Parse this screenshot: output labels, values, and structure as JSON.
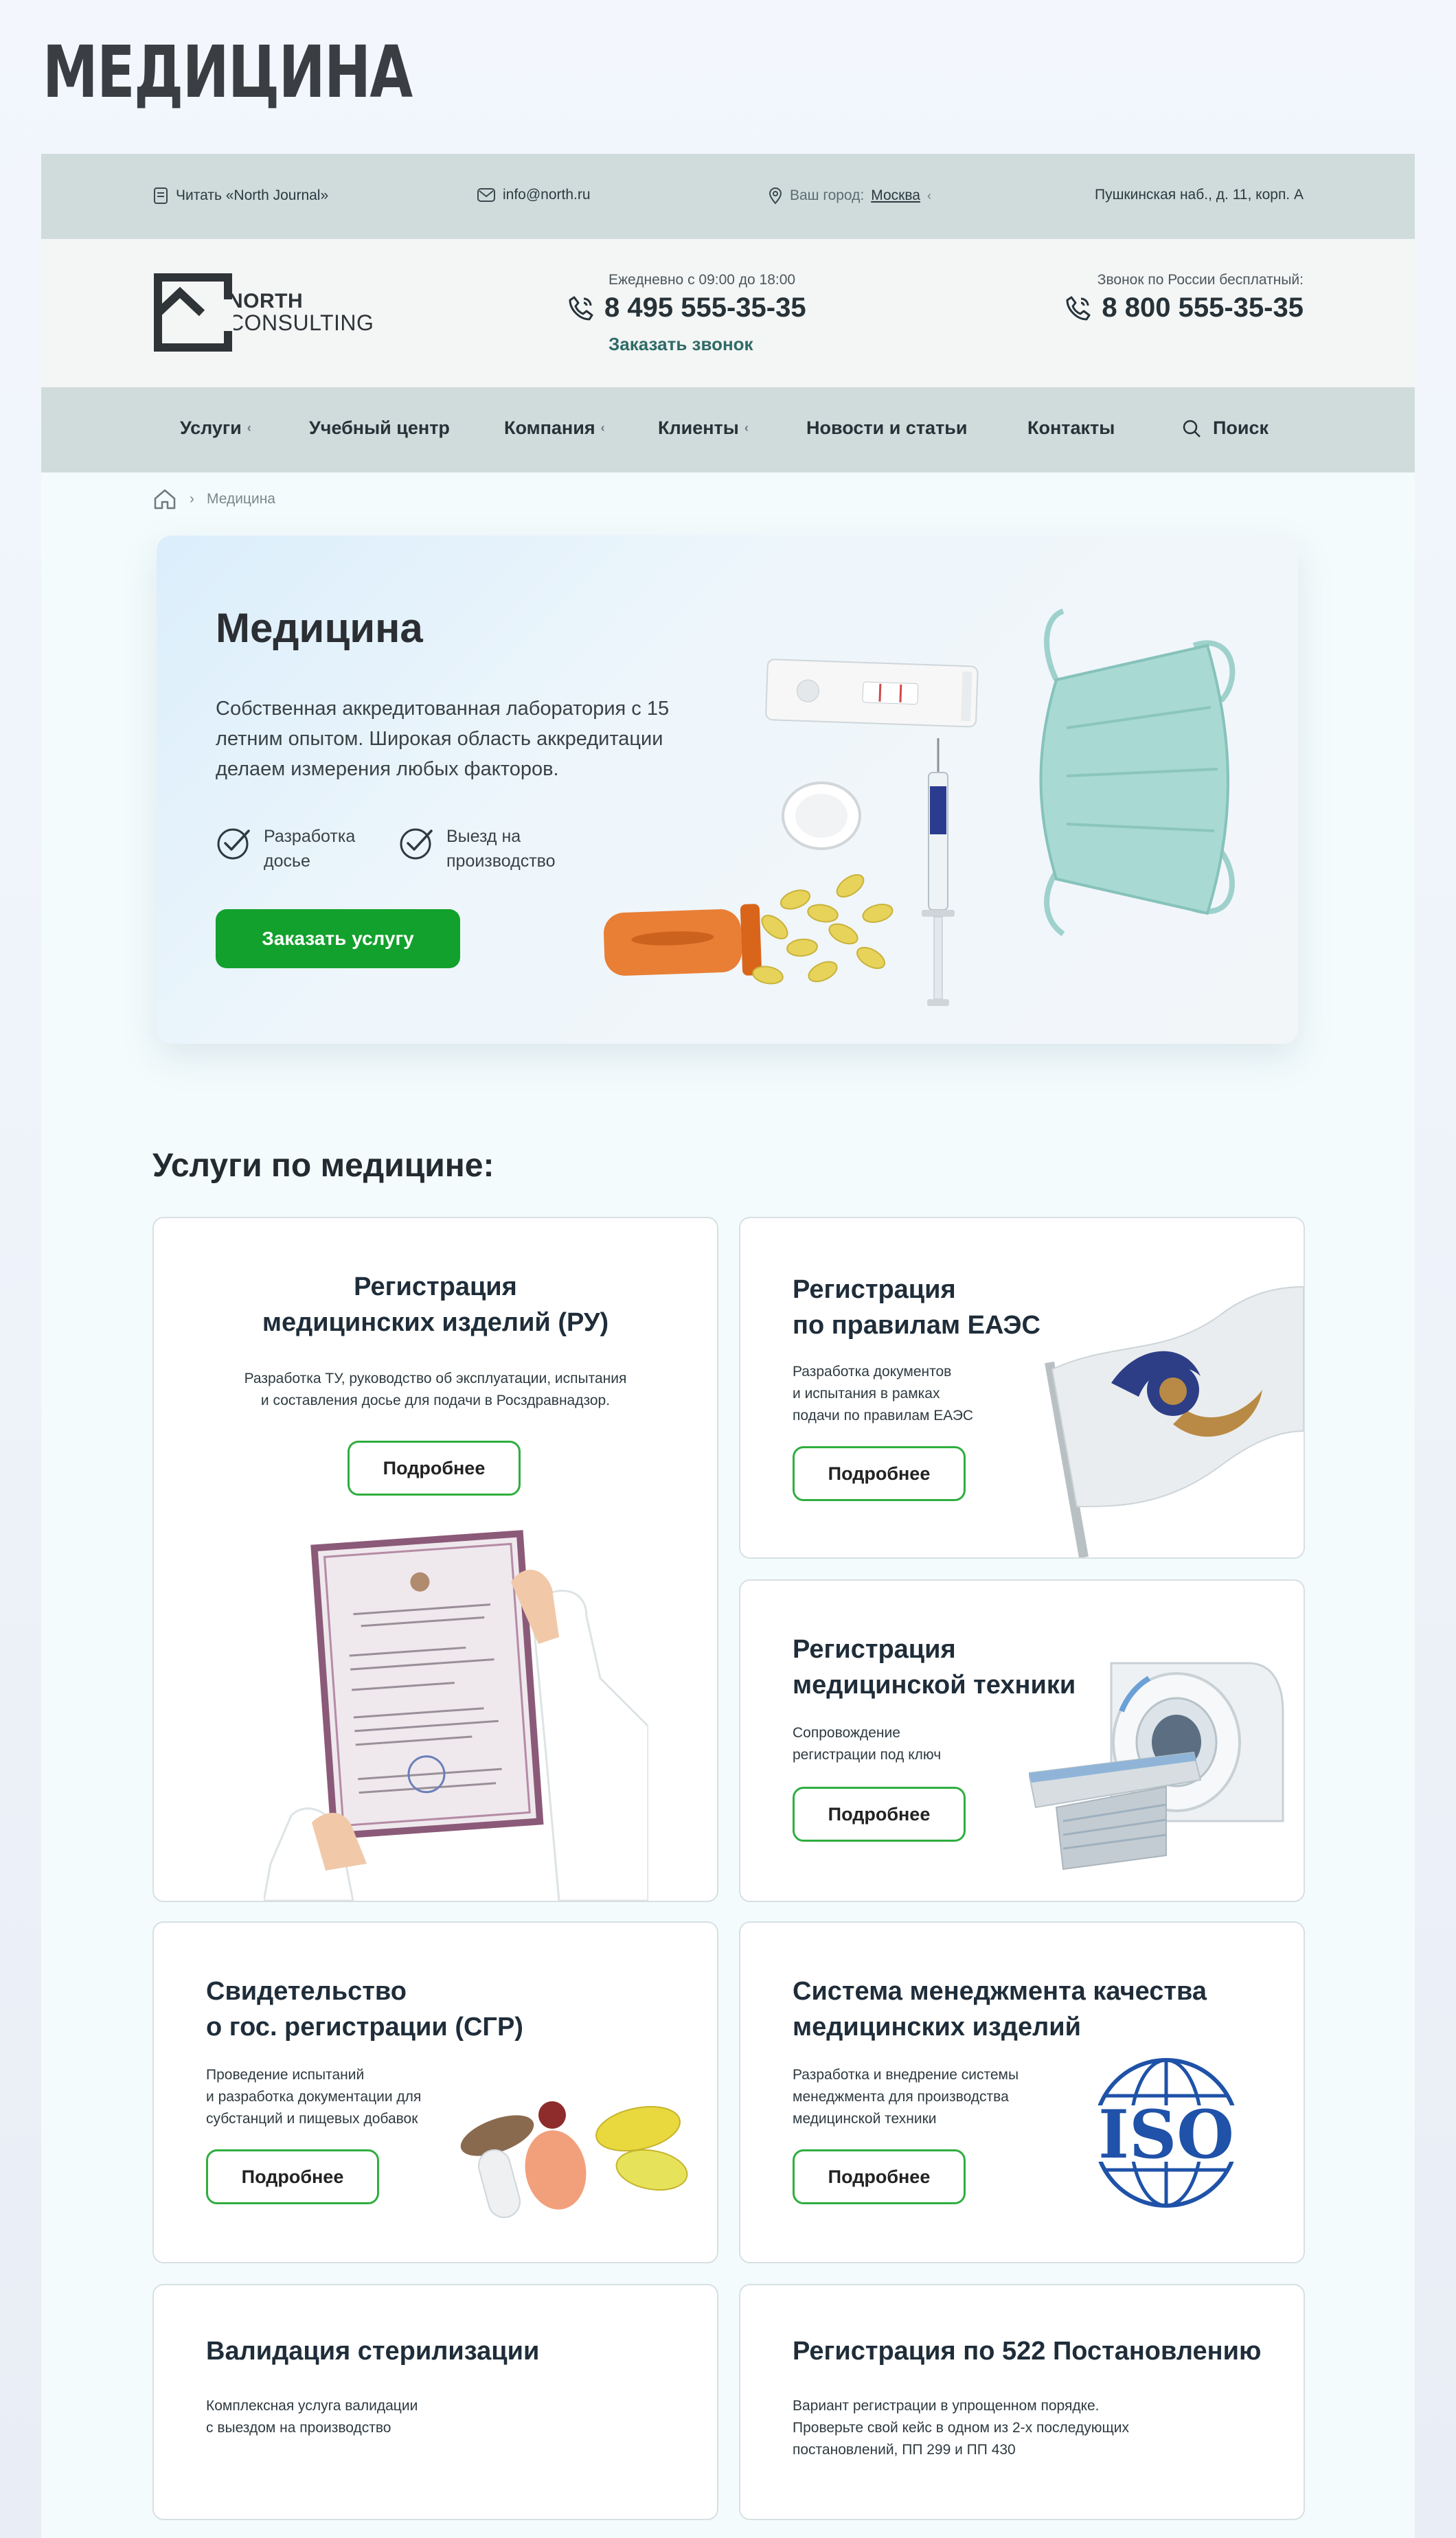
{
  "presentation_title": "МЕДИЦИНА",
  "topbar": {
    "journal": "Читать «North Journal»",
    "email": "info@north.ru",
    "city_label": "Ваш город:",
    "city": "Москва",
    "address": "Пушкинская наб., д. 11, корп. А"
  },
  "header": {
    "logo_line1": "NORTH",
    "logo_line2": "CONSULTING",
    "hours": "Ежедневно с 09:00 до 18:00",
    "phone_main": "8 495 555-35-35",
    "callback": "Заказать звонок",
    "free_label": "Звонок по России бесплатный:",
    "phone_free": "8 800 555-35-35"
  },
  "nav": {
    "items": [
      "Услуги",
      "Учебный центр",
      "Компания",
      "Клиенты",
      "Новости и статьи",
      "Контакты"
    ],
    "search": "Поиск"
  },
  "breadcrumb": {
    "current": "Медицина"
  },
  "hero": {
    "title": "Медицина",
    "text": "Собственная аккредитованная лаборатория с 15 летним опытом. Широкая область аккредитации делаем измерения любых факторов.",
    "feature1_l1": "Разработка",
    "feature1_l2": "досье",
    "feature2_l1": "Выезд на",
    "feature2_l2": "производство",
    "button": "Заказать услугу"
  },
  "services": {
    "title": "Услуги по медицине:",
    "more": "Подробнее",
    "cards": [
      {
        "t1": "Регистрация",
        "t2": "медицинских изделий (РУ)",
        "d1": "Разработка ТУ, руководство об эксплуатации, испытания",
        "d2": "и составления досье для подачи в Росздравнадзор."
      },
      {
        "t1": "Регистрация",
        "t2": "по правилам ЕАЭС",
        "d1": "Разработка документов",
        "d2": "и испытания в рамках",
        "d3": "подачи по правилам ЕАЭС"
      },
      {
        "t1": "Регистрация",
        "t2": "медицинской техники",
        "d1": "Сопровождение",
        "d2": "регистрации под ключ"
      },
      {
        "t1": "Свидетельство",
        "t2": "о гос. регистрации (СГР)",
        "d1": "Проведение испытаний",
        "d2": "и разработка документации для",
        "d3": "субстанций и пищевых добавок"
      },
      {
        "t1": "Система менеджмента качества",
        "t2": "медицинских изделий",
        "d1": "Разработка и внедрение системы",
        "d2": "менеджмента для производства",
        "d3": "медицинской техники"
      },
      {
        "t1": "Валидация стерилизации",
        "d1": "Комплексная услуга валидации",
        "d2": "с выездом на производство"
      },
      {
        "t1": "Регистрация по 522 Постановлению",
        "d1": "Вариант регистрации в упрощенном порядке.",
        "d2": "Проверьте свой кейс в одном из 2-х последующих",
        "d3": "постановлений, ПП 299 и ПП 430"
      }
    ],
    "iso_label": "ISO"
  },
  "colors": {
    "accent_green": "#12a12c",
    "outline_green": "#2fae3f",
    "bar_bg": "#cfdcdb",
    "link_teal": "#2e6b66"
  }
}
